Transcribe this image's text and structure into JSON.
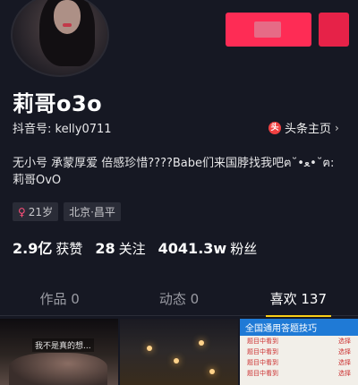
{
  "profile": {
    "username": "莉哥o3o",
    "douyin_id": "抖音号: kelly0711",
    "bio_line1": "无小号 承蒙厚爱 倍感珍惜????Babe们来国脖找我吧ฅ˘•ﻌ•˘ฅ:",
    "bio_line2": "莉哥OvO",
    "toutiao_link": "头条主页",
    "toutiao_icon": "toutiao-icon",
    "toutiao_icon_glyph": "头"
  },
  "tags": {
    "age": "21岁",
    "location": "北京·昌平",
    "gender_icon": "female-icon",
    "gender_glyph": "♀"
  },
  "stats": {
    "likes_num": "2.9亿",
    "likes_label": "获赞",
    "following_num": "28",
    "following_label": "关注",
    "followers_num": "4041.3w",
    "followers_label": "粉丝"
  },
  "tabs": [
    {
      "label": "作品 0"
    },
    {
      "label": "动态 0"
    },
    {
      "label": "喜欢 137"
    }
  ],
  "thumbnails": {
    "cell1_caption": "我不是真的想...",
    "cell3_header": "全国通用答题技巧",
    "cell3_rows": [
      [
        "题目中看到",
        "选择"
      ],
      [
        "题目中看到",
        "选择"
      ],
      [
        "题目中看到",
        "选择"
      ],
      [
        "题目中看到",
        "选择"
      ]
    ]
  },
  "colors": {
    "background": "#161823",
    "follow_button": "#fe2c55",
    "tab_indicator": "#face15"
  }
}
